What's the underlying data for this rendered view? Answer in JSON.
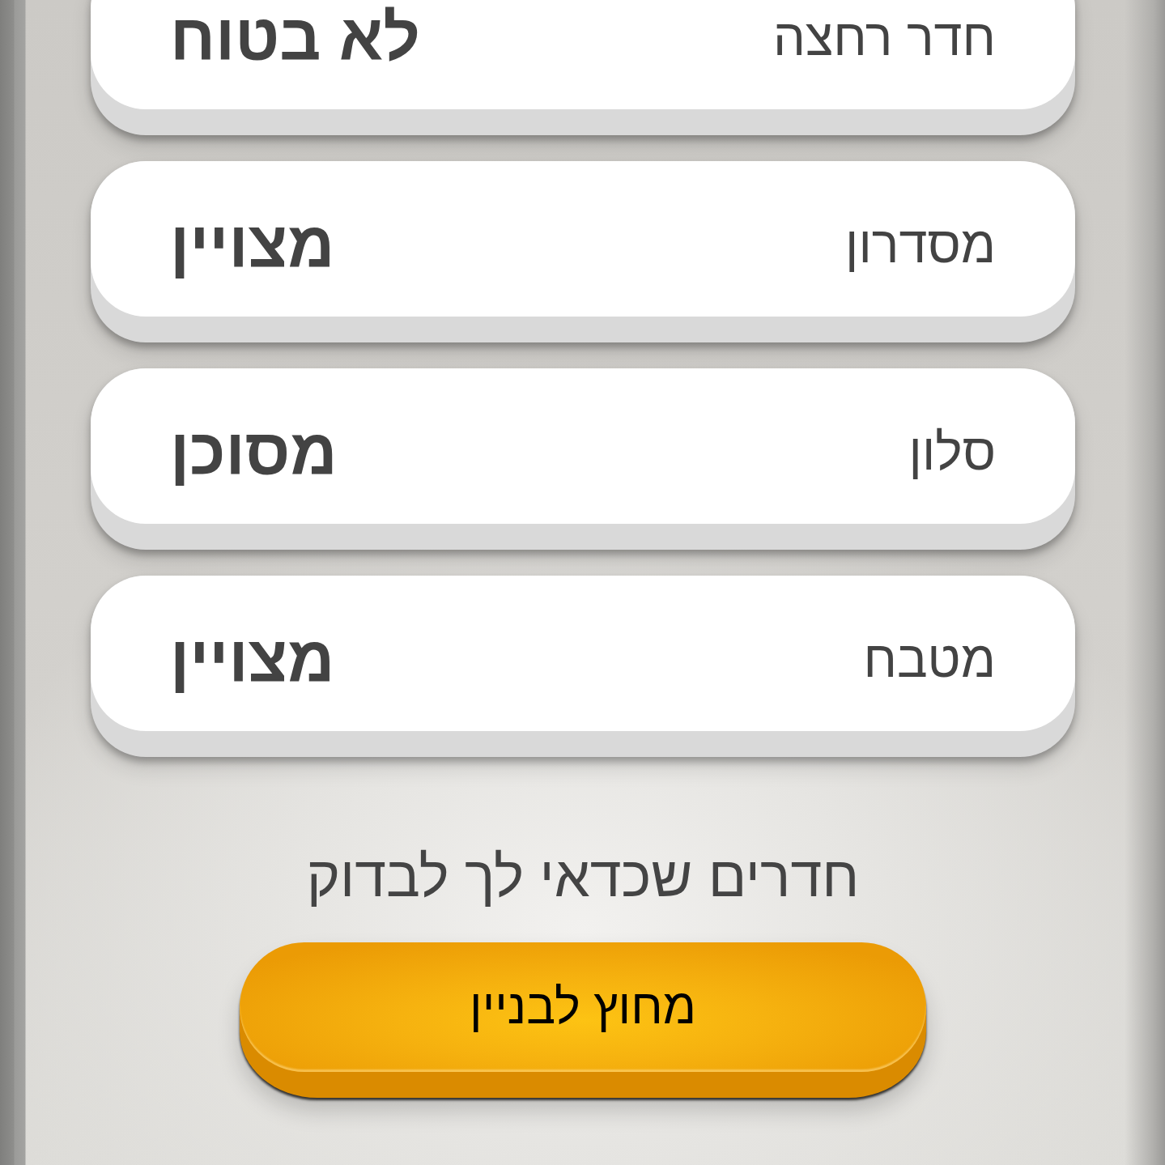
{
  "rooms": [
    {
      "name": "חדר רחצה",
      "rating": "לא בטוח"
    },
    {
      "name": "מסדרון",
      "rating": "מצויין"
    },
    {
      "name": "סלון",
      "rating": "מסוכן"
    },
    {
      "name": "מטבח",
      "rating": "מצויין"
    }
  ],
  "section_title": "חדרים שכדאי לך לבדוק",
  "button": {
    "label": "מחוץ לבניין"
  }
}
